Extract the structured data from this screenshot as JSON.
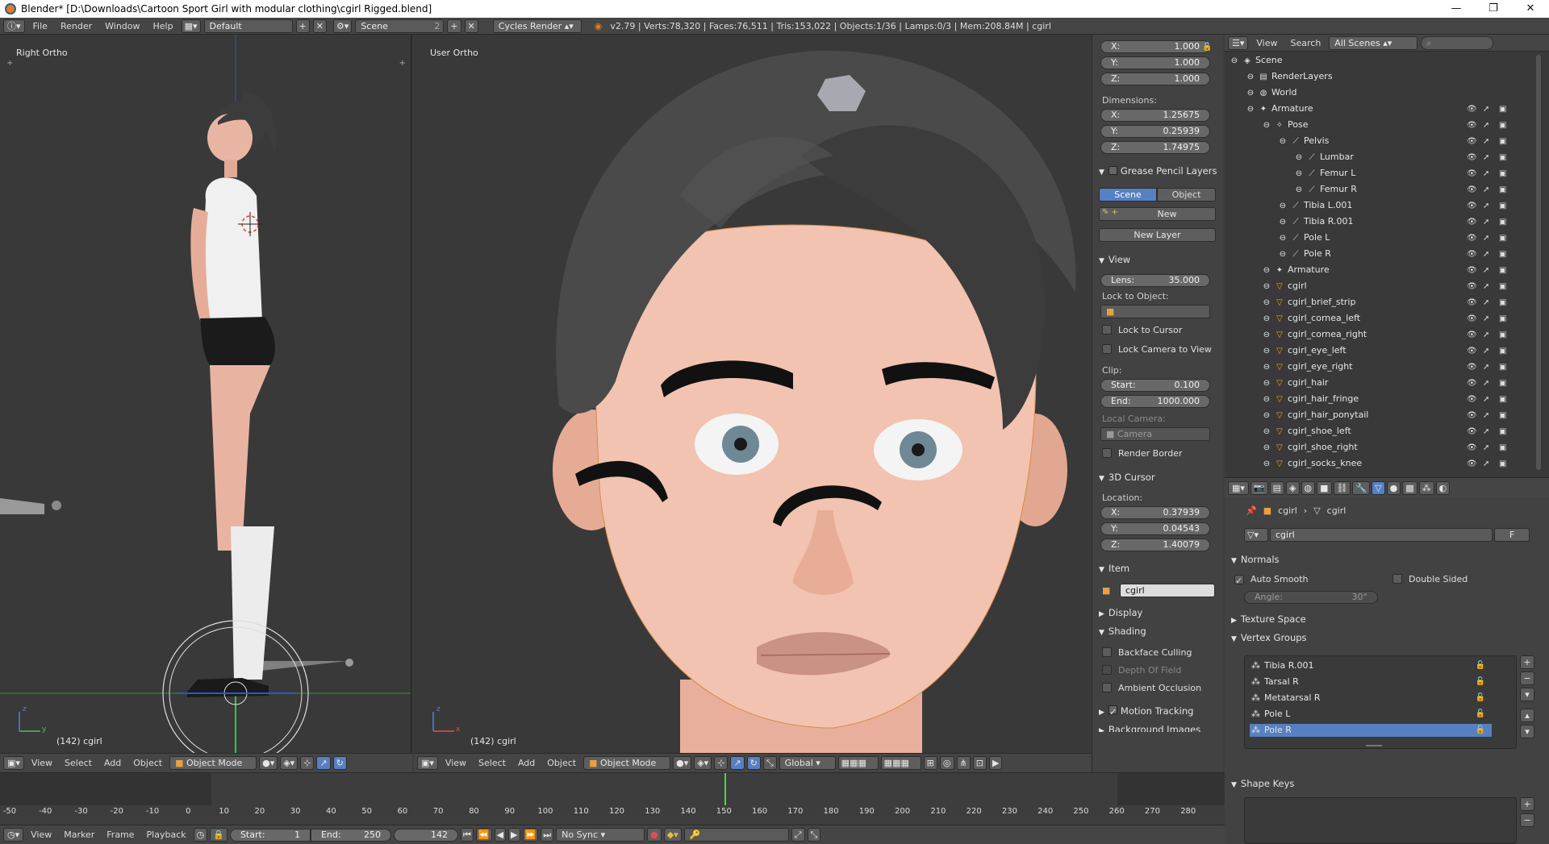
{
  "window": {
    "title": "Blender* [D:\\Downloads\\Cartoon Sport Girl with modular clothing\\cgirl Rigged.blend]",
    "controls": [
      "—",
      "❐",
      "✕"
    ]
  },
  "infobar": {
    "menus": [
      "File",
      "Render",
      "Window",
      "Help"
    ],
    "layout": "Default",
    "scene": "Scene",
    "scene_users": "2",
    "render_engine": "Cycles Render",
    "stats": "v2.79 | Verts:78,320 | Faces:76,511 | Tris:153,022 | Objects:1/36 | Lamps:0/3 | Mem:208.84M | cgirl"
  },
  "left_view": {
    "label": "Right Ortho",
    "frame_label": "(142) cgirl",
    "axis_z": "z",
    "axis_y": "y",
    "header": {
      "menus": [
        "View",
        "Select",
        "Add",
        "Object"
      ],
      "mode": "Object Mode"
    }
  },
  "right_view": {
    "label": "User Ortho",
    "frame_label": "(142) cgirl",
    "axis_z": "z",
    "axis_x": "x",
    "header": {
      "menus": [
        "View",
        "Select",
        "Add",
        "Object"
      ],
      "mode": "Object Mode",
      "orientation": "Global"
    }
  },
  "npanel": {
    "scale": [
      {
        "label": "X:",
        "value": "1.000"
      },
      {
        "label": "Y:",
        "value": "1.000"
      },
      {
        "label": "Z:",
        "value": "1.000"
      }
    ],
    "dimensions_label": "Dimensions:",
    "dimensions": [
      {
        "label": "X:",
        "value": "1.25675"
      },
      {
        "label": "Y:",
        "value": "0.25939"
      },
      {
        "label": "Z:",
        "value": "1.74975"
      }
    ],
    "grease_pencil": {
      "title": "Grease Pencil Layers",
      "tab_scene": "Scene",
      "tab_object": "Object",
      "new": "New",
      "new_layer": "New Layer"
    },
    "view": {
      "title": "View",
      "lens_label": "Lens:",
      "lens": "35.000",
      "lock_to_object": "Lock to Object:",
      "lock_to_cursor": "Lock to Cursor",
      "lock_camera": "Lock Camera to View",
      "clip": "Clip:",
      "clip_start_label": "Start:",
      "clip_start": "0.100",
      "clip_end_label": "End:",
      "clip_end": "1000.000",
      "local_camera": "Local Camera:",
      "camera": "Camera",
      "render_border": "Render Border"
    },
    "cursor": {
      "title": "3D Cursor",
      "location": "Location:",
      "x": "0.37939",
      "y": "0.04543",
      "z": "1.40079"
    },
    "item": {
      "title": "Item",
      "name": "cgirl"
    },
    "display": "Display",
    "shading": {
      "title": "Shading",
      "backface": "Backface Culling",
      "dof": "Depth Of Field",
      "ao": "Ambient Occlusion"
    },
    "motion_tracking": "Motion Tracking",
    "background_images": "Background Images"
  },
  "outliner": {
    "menus": [
      "View",
      "Search"
    ],
    "filter": "All Scenes",
    "rows": [
      {
        "label": "Scene",
        "indent": 0,
        "icon": "◈"
      },
      {
        "label": "RenderLayers",
        "indent": 1,
        "icon": "▤"
      },
      {
        "label": "World",
        "indent": 1,
        "icon": "◍"
      },
      {
        "label": "Armature",
        "indent": 1,
        "icon": "✦"
      },
      {
        "label": "Pose",
        "indent": 2,
        "icon": "✧"
      },
      {
        "label": "Pelvis",
        "indent": 3,
        "icon": "⟋"
      },
      {
        "label": "Lumbar",
        "indent": 4,
        "icon": "⟋"
      },
      {
        "label": "Femur L",
        "indent": 4,
        "icon": "⟋"
      },
      {
        "label": "Femur R",
        "indent": 4,
        "icon": "⟋"
      },
      {
        "label": "Tibia L.001",
        "indent": 3,
        "icon": "⟋"
      },
      {
        "label": "Tibia R.001",
        "indent": 3,
        "icon": "⟋"
      },
      {
        "label": "Pole L",
        "indent": 3,
        "icon": "⟋"
      },
      {
        "label": "Pole R",
        "indent": 3,
        "icon": "⟋"
      },
      {
        "label": "Armature",
        "indent": 2,
        "icon": "✦"
      },
      {
        "label": "cgirl",
        "indent": 2,
        "icon": "▽"
      },
      {
        "label": "cgirl_brief_strip",
        "indent": 2,
        "icon": "▽"
      },
      {
        "label": "cgirl_cornea_left",
        "indent": 2,
        "icon": "▽"
      },
      {
        "label": "cgirl_cornea_right",
        "indent": 2,
        "icon": "▽"
      },
      {
        "label": "cgirl_eye_left",
        "indent": 2,
        "icon": "▽"
      },
      {
        "label": "cgirl_eye_right",
        "indent": 2,
        "icon": "▽"
      },
      {
        "label": "cgirl_hair",
        "indent": 2,
        "icon": "▽"
      },
      {
        "label": "cgirl_hair_fringe",
        "indent": 2,
        "icon": "▽"
      },
      {
        "label": "cgirl_hair_ponytail",
        "indent": 2,
        "icon": "▽"
      },
      {
        "label": "cgirl_shoe_left",
        "indent": 2,
        "icon": "▽"
      },
      {
        "label": "cgirl_shoe_right",
        "indent": 2,
        "icon": "▽"
      },
      {
        "label": "cgirl_socks_knee",
        "indent": 2,
        "icon": "▽"
      }
    ]
  },
  "properties": {
    "breadcrumb": [
      "cgirl",
      "cgirl"
    ],
    "mesh_name": "cgirl",
    "fake_user": "F",
    "normals": {
      "title": "Normals",
      "auto_smooth": "Auto Smooth",
      "double_sided": "Double Sided",
      "angle_label": "Angle:",
      "angle": "30°"
    },
    "texture_space": "Texture Space",
    "vertex_groups": {
      "title": "Vertex Groups",
      "items": [
        "Tibia R.001",
        "Tarsal R",
        "Metatarsal R",
        "Pole L",
        "Pole R"
      ],
      "selected": 4
    },
    "shape_keys": "Shape Keys"
  },
  "timeline": {
    "ticks": [
      "-50",
      "-40",
      "-30",
      "-20",
      "-10",
      "0",
      "10",
      "20",
      "30",
      "40",
      "50",
      "60",
      "70",
      "80",
      "90",
      "100",
      "110",
      "120",
      "130",
      "140",
      "150",
      "160",
      "170",
      "180",
      "190",
      "200",
      "210",
      "220",
      "230",
      "240",
      "250",
      "260",
      "270",
      "280"
    ],
    "menus": [
      "View",
      "Marker",
      "Frame",
      "Playback"
    ],
    "start_label": "Start:",
    "start": "1",
    "end_label": "End:",
    "end": "250",
    "current": "142",
    "sync": "No Sync"
  },
  "colors": {
    "accent": "#e87d0d",
    "selected": "#5680c2",
    "viewport": "#393939",
    "panel": "#424242"
  }
}
